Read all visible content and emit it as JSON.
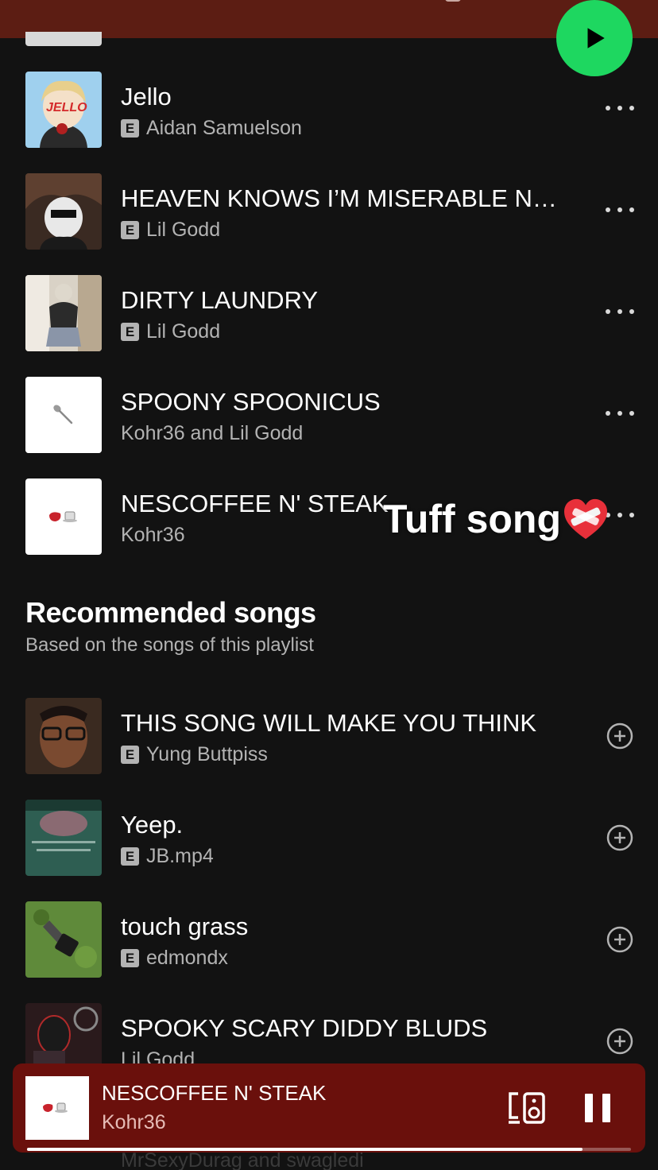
{
  "colors": {
    "accent": "#1ed760",
    "header": "#5c1d13",
    "mini_player": "#6a100c"
  },
  "play_button": {
    "icon": "play-icon"
  },
  "playlist_tracks": [
    {
      "title": "Jello",
      "artist": "Aidan Samuelson",
      "explicit": true,
      "badge": "E"
    },
    {
      "title": "HEAVEN KNOWS I’M MISERABLE NO…",
      "artist": "Lil Godd",
      "explicit": true,
      "badge": "E"
    },
    {
      "title": "DIRTY LAUNDRY",
      "artist": "Lil Godd",
      "explicit": true,
      "badge": "E"
    },
    {
      "title": "SPOONY SPOONICUS",
      "artist": "Kohr36 and Lil Godd",
      "explicit": false
    },
    {
      "title": "NESCOFFEE N' STEAK",
      "artist": "Kohr36",
      "explicit": false
    }
  ],
  "sticker": {
    "text": "Tuff song",
    "emoji": "mending-heart"
  },
  "recommended": {
    "title": "Recommended songs",
    "subtitle": "Based on the songs of this playlist",
    "tracks": [
      {
        "title": "THIS SONG WILL MAKE YOU THINK",
        "artist": "Yung Buttpiss",
        "explicit": true,
        "badge": "E"
      },
      {
        "title": "Yeep.",
        "artist": "JB.mp4",
        "explicit": true,
        "badge": "E"
      },
      {
        "title": "touch grass",
        "artist": "edmondx",
        "explicit": true,
        "badge": "E"
      },
      {
        "title": "SPOOKY SCARY DIDDY BLUDS",
        "artist": "Lil Godd",
        "explicit": false
      }
    ],
    "partially_hidden_artist": "MrSexyDurag and swagledi"
  },
  "now_playing": {
    "title": "NESCOFFEE N' STEAK",
    "artist": "Kohr36",
    "progress": 0.92,
    "devices_icon": "devices-icon",
    "pause_icon": "pause-icon"
  }
}
